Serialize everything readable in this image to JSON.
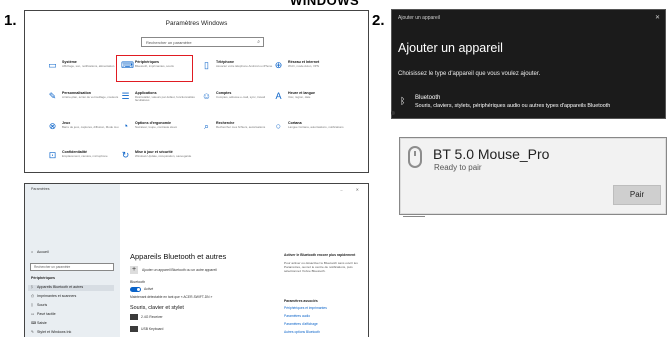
{
  "header": {
    "cut_title": "WINDOWS"
  },
  "steps": {
    "one": "1.",
    "two": "2."
  },
  "settings_home": {
    "title": "Paramètres Windows",
    "search_placeholder": "Rechercher un paramètre",
    "tiles": [
      {
        "title": "Système",
        "desc": "Affichage, son, notifications, alimentation",
        "icon": "laptop-icon"
      },
      {
        "title": "Périphériques",
        "desc": "Bluetooth, imprimantes, souris",
        "icon": "keyboard-icon",
        "highlighted": true
      },
      {
        "title": "Téléphone",
        "desc": "Associer votre téléphone Android ou iPhone",
        "icon": "phone-icon"
      },
      {
        "title": "Réseau et Internet",
        "desc": "Wi-Fi, mode Avion, VPN",
        "icon": "globe-icon"
      },
      {
        "title": "Personnalisation",
        "desc": "Arrière-plan, écran de verrouillage, couleurs",
        "icon": "brush-icon"
      },
      {
        "title": "Applications",
        "desc": "Désinstaller, valeurs par défaut, fonctionnalités facultatives",
        "icon": "apps-icon"
      },
      {
        "title": "Comptes",
        "desc": "Comptes, adresse e-mail, sync, travail",
        "icon": "person-icon"
      },
      {
        "title": "Heure et langue",
        "desc": "Voix, région, date",
        "icon": "time-language-icon"
      },
      {
        "title": "Jeux",
        "desc": "Barre de jeux, captures, diffusion, Mode Jeu",
        "icon": "xbox-icon"
      },
      {
        "title": "Options d'ergonomie",
        "desc": "Narrateur, loupe, contraste élevé",
        "icon": "ease-of-access-icon"
      },
      {
        "title": "Recherche",
        "desc": "Rechercher mes fichiers, autorisations",
        "icon": "search-icon"
      },
      {
        "title": "Cortana",
        "desc": "Langue Cortana, autorisations, notifications",
        "icon": "cortana-icon"
      },
      {
        "title": "Confidentialité",
        "desc": "Emplacement, caméra, microphone",
        "icon": "lock-icon"
      },
      {
        "title": "Mise à jour et sécurité",
        "desc": "Windows Update, récupération, sauvegarde",
        "icon": "sync-icon"
      }
    ]
  },
  "add_device": {
    "window_title": "Ajouter un appareil",
    "close_label": "✕",
    "heading": "Ajouter un appareil",
    "subtitle": "Choisissez le type d'appareil que vous voulez ajouter.",
    "option_name": "Bluetooth",
    "option_desc": "Souris, claviers, stylets, périphériques audio ou autres types d'appareils Bluetooth"
  },
  "found_device": {
    "name": "BT 5.0 Mouse_Pro",
    "status": "Ready to pair",
    "pair_label": "Pair"
  },
  "bt_settings": {
    "window_caption": "Paramètres",
    "nav": {
      "home": "Accueil",
      "search_placeholder": "Rechercher un paramètre",
      "section": "Périphériques",
      "items": [
        {
          "label": "Appareils Bluetooth et autres",
          "icon": "bluetooth-icon",
          "active": true
        },
        {
          "label": "Imprimantes et scanners",
          "icon": "printer-icon"
        },
        {
          "label": "Souris",
          "icon": "mouse-icon"
        },
        {
          "label": "Pavé tactile",
          "icon": "touchpad-icon"
        },
        {
          "label": "Saisie",
          "icon": "keyboard-icon"
        },
        {
          "label": "Stylet et Windows Ink",
          "icon": "pen-icon"
        }
      ]
    },
    "main": {
      "title": "Appareils Bluetooth et autres",
      "add_label": "Ajouter un appareil Bluetooth ou un autre appareil",
      "bluetooth_label": "Bluetooth",
      "toggle_label": "Activé",
      "discoverable": "Maintenant détectable en tant que « ACER-SWIFT-DN »",
      "section": "Souris, clavier et stylet",
      "devices": [
        "2.4G Receiver",
        "USB Keyboard"
      ]
    },
    "side_panel": {
      "heading": "Activer le Bluetooth encore plus rapidement",
      "text": "Pour activer ou désactiver le Bluetooth sans ouvrir les Paramètres, ouvrez le centre de notifications, puis sélectionnez l'icône Bluetooth.",
      "related_heading": "Paramètres associés",
      "links": [
        "Périphériques et imprimantes",
        "Paramètres audio",
        "Paramètres d'affichage",
        "Autres options Bluetooth"
      ]
    }
  }
}
